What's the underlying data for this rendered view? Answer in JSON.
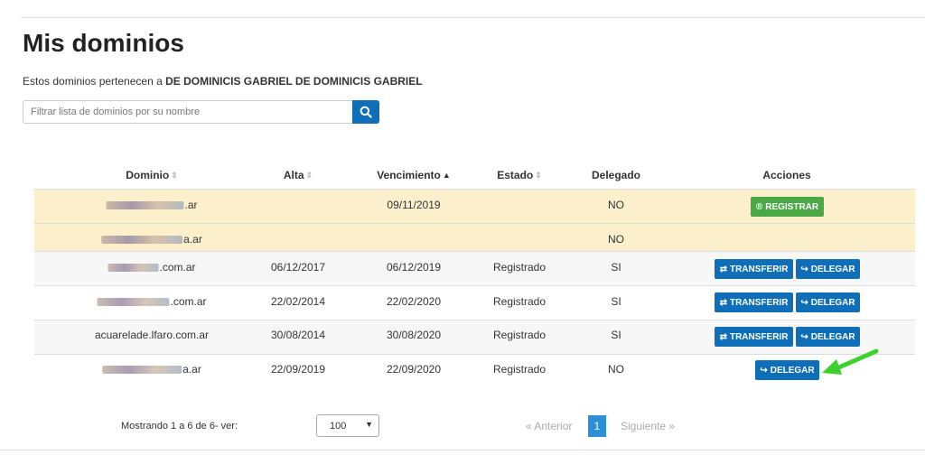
{
  "page": {
    "title": "Mis dominios",
    "owner_prefix": "Estos dominios pertenecen a",
    "owner_name": "DE DOMINICIS GABRIEL DE DOMINICIS GABRIEL"
  },
  "search": {
    "placeholder": "Filtrar lista de dominios por su nombre",
    "button_icon": "search-icon"
  },
  "table": {
    "headers": {
      "domain": "Dominio",
      "alta": "Alta",
      "vencimiento": "Vencimiento",
      "estado": "Estado",
      "delegado": "Delegado",
      "acciones": "Acciones"
    },
    "rows": [
      {
        "domain": ".ar",
        "alta": "",
        "vencimiento": "09/11/2019",
        "estado": "",
        "delegado": "NO",
        "highlight": "warning"
      },
      {
        "domain": "a.ar",
        "alta": "",
        "vencimiento": "",
        "estado": "",
        "delegado": "NO",
        "highlight": "warning"
      },
      {
        "domain": ".com.ar",
        "alta": "06/12/2017",
        "vencimiento": "06/12/2019",
        "estado": "Registrado",
        "delegado": "SI",
        "highlight": "striped"
      },
      {
        "domain": ".com.ar",
        "alta": "22/02/2014",
        "vencimiento": "22/02/2020",
        "estado": "Registrado",
        "delegado": "SI",
        "highlight": "none"
      },
      {
        "domain": "acuarelade.lfaro.com.ar",
        "alta": "30/08/2014",
        "vencimiento": "30/08/2020",
        "estado": "Registrado",
        "delegado": "SI",
        "highlight": "striped"
      },
      {
        "domain": "a.ar",
        "alta": "22/09/2019",
        "vencimiento": "22/09/2020",
        "estado": "Registrado",
        "delegado": "NO",
        "highlight": "none"
      }
    ]
  },
  "actions": {
    "registrar": "REGISTRAR",
    "transferir": "TRANSFERIR",
    "delegar": "DELEGAR"
  },
  "footer": {
    "showing": "Mostrando 1 a 6 de 6- ver:",
    "page_size": "100",
    "prev": "« Anterior",
    "current_page": "1",
    "next": "Siguiente »"
  },
  "colors": {
    "primary": "#0e6fb8",
    "success": "#4aa845",
    "warning_row": "#fcf0cc",
    "annotation_arrow": "#3ed12e"
  }
}
